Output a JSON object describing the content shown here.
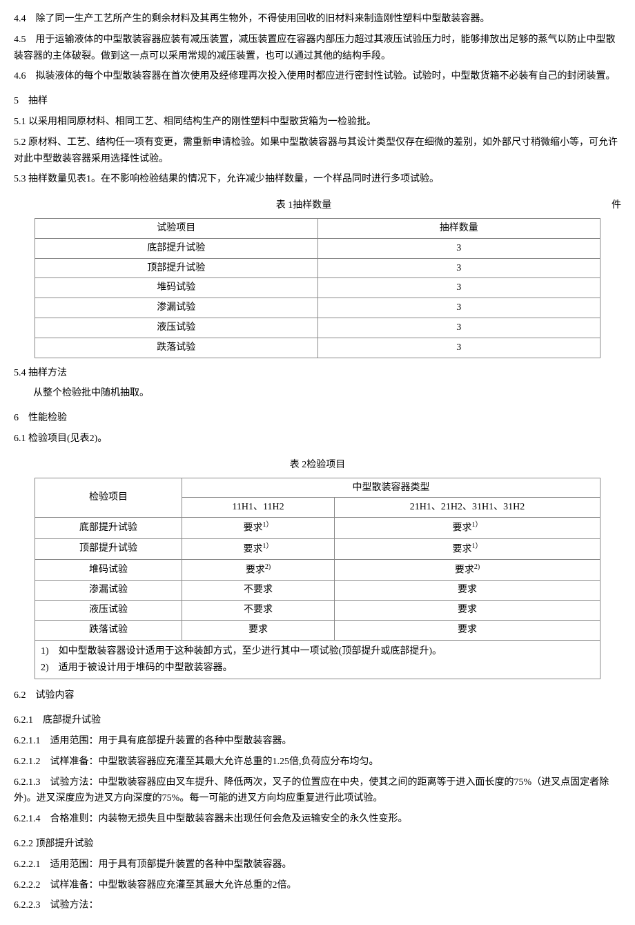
{
  "p44": "4.4　除了同一生产工艺所产生的剩余材料及其再生物外，不得使用回收的旧材料来制造刚性塑料中型散装容器。",
  "p45": "4.5　用于运输液体的中型散装容器应装有减压装置，减压装置应在容器内部压力超过其液压试验压力时，能够排放出足够的蒸气以防止中型散装容器的主体破裂。做到这一点可以采用常规的减压装置，也可以通过其他的结构手段。",
  "p46": "4.6　拟装液体的每个中型散装容器在首次使用及经修理再次投入使用时都应进行密封性试验。试验时，中型散货箱不必装有自己的封闭装置。",
  "s5": "5　抽样",
  "p51": "5.1 以采用相同原材料、相同工艺、相同结构生产的刚性塑料中型散货箱为一检验批。",
  "p52": "5.2 原材料、工艺、结构任一项有变更，需重新申请检验。如果中型散装容器与其设计类型仅存在细微的差别，如外部尺寸稍微缩小等，可允许对此中型散装容器采用选择性试验。",
  "p53": "5.3 抽样数量见表1。在不影响检验结果的情况下，允许减少抽样数量，一个样品同时进行多项试验。",
  "table1": {
    "caption": "表 1抽样数量",
    "unit": "件",
    "headers": [
      "试验项目",
      "抽样数量"
    ],
    "rows": [
      [
        "底部提升试验",
        "3"
      ],
      [
        "顶部提升试验",
        "3"
      ],
      [
        "堆码试验",
        "3"
      ],
      [
        "渗漏试验",
        "3"
      ],
      [
        "液压试验",
        "3"
      ],
      [
        "跌落试验",
        "3"
      ]
    ]
  },
  "p54": "5.4 抽样方法",
  "p54a": "从整个检验批中随机抽取。",
  "s6": "6　性能检验",
  "p61": "6.1 检验项目(见表2)。",
  "table2": {
    "caption": "表 2检验项目",
    "h_item": "检验项目",
    "h_type": "中型散装容器类型",
    "h_sub1": "11H1、11H2",
    "h_sub2": "21H1、21H2、31H1、31H2",
    "rows": [
      [
        "底部提升试验",
        "要求",
        "1）",
        "要求",
        "1）"
      ],
      [
        "顶部提升试验",
        "要求",
        "1）",
        "要求",
        "1）"
      ],
      [
        "堆码试验",
        "要求",
        "2)",
        "要求",
        "2)"
      ],
      [
        "渗漏试验",
        "不要求",
        "",
        "要求",
        ""
      ],
      [
        "液压试验",
        "不要求",
        "",
        "要求",
        ""
      ],
      [
        "跌落试验",
        "要求",
        "",
        "要求",
        ""
      ]
    ],
    "note1": "1)　如中型散装容器设计适用于这种装卸方式，至少进行其中一项试验(顶部提升或底部提升)。",
    "note2": "2)　适用于被设计用于堆码的中型散装容器。"
  },
  "p62": "6.2　试验内容",
  "p621": "6.2.1　底部提升试验",
  "p6211": "6.2.1.1　适用范围：用于具有底部提升装置的各种中型散装容器。",
  "p6212": "6.2.1.2　试样准备：中型散装容器应充灌至其最大允许总重的1.25倍,负荷应分布均匀。",
  "p6213": "6.2.1.3　试验方法：中型散装容器应由叉车提升、降低两次，叉子的位置应在中央，使其之间的距离等于进入面长度的75%（进叉点固定者除外)。进叉深度应为进叉方向深度的75%。每一可能的进叉方向均应重复进行此项试验。",
  "p6214": "6.2.1.4　合格准则：内装物无损失且中型散装容器未出现任何会危及运输安全的永久性变形。",
  "p622": "6.2.2 顶部提升试验",
  "p6221": "6.2.2.1　适用范围：用于具有顶部提升装置的各种中型散装容器。",
  "p6222": "6.2.2.2　试样准备：中型散装容器应充灌至其最大允许总重的2倍。",
  "p6223": "6.2.2.3　试验方法："
}
